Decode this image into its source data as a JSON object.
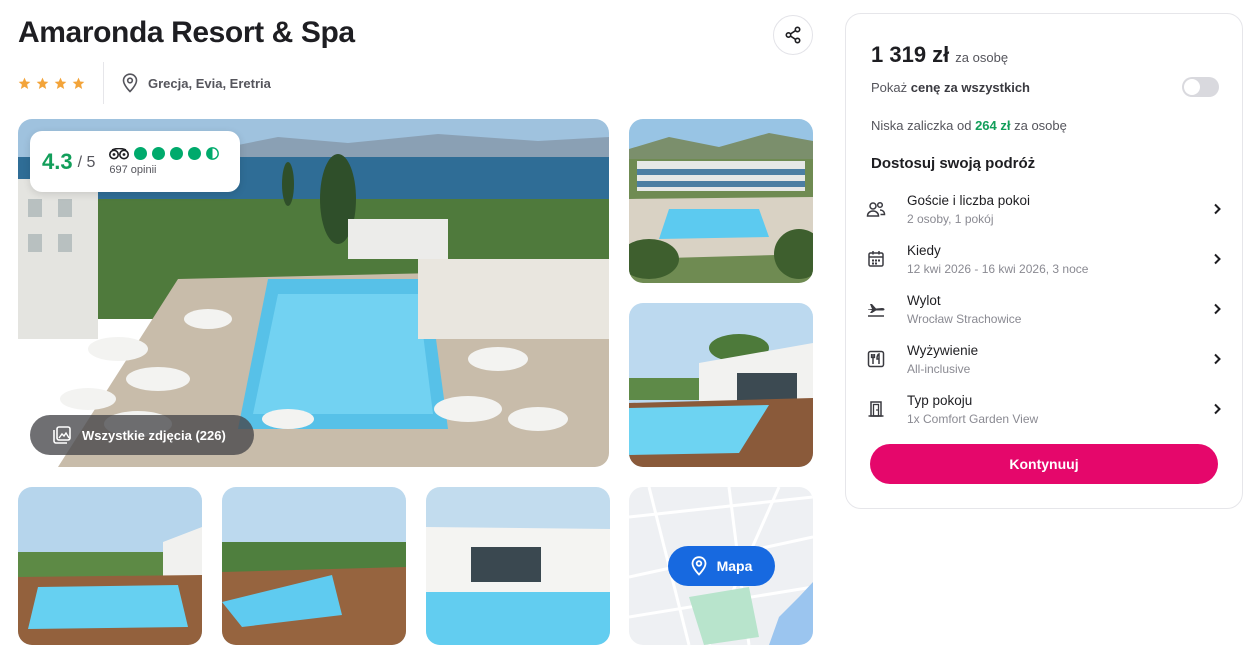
{
  "hotel": {
    "name": "Amaronda Resort & Spa",
    "stars": 4,
    "location": "Grecja, Evia, Eretria"
  },
  "rating": {
    "score": "4.3",
    "max": "/ 5",
    "tripadvisor_bubbles": 4.5,
    "reviews": "697 opinii"
  },
  "gallery": {
    "all_photos_label": "Wszystkie zdjęcia (226)",
    "map_label": "Mapa"
  },
  "booking": {
    "price": "1 319 zł",
    "per_person": "za osobę",
    "toggle_prefix": "Pokaż",
    "toggle_bold": "cenę za wszystkich",
    "deposit_prefix": "Niska zaliczka od",
    "deposit_amount": "264 zł",
    "deposit_suffix": "za osobę",
    "customize_title": "Dostosuj swoją podróż",
    "options": [
      {
        "title": "Goście i liczba pokoi",
        "value": "2 osoby, 1 pokój",
        "icon": "guests-icon"
      },
      {
        "title": "Kiedy",
        "value": "12 kwi 2026 - 16 kwi 2026, 3 noce",
        "icon": "calendar-icon"
      },
      {
        "title": "Wylot",
        "value": "Wrocław Strachowice",
        "icon": "plane-icon"
      },
      {
        "title": "Wyżywienie",
        "value": "All-inclusive",
        "icon": "meal-icon"
      },
      {
        "title": "Typ pokoju",
        "value": "1x Comfort Garden View",
        "icon": "door-icon"
      }
    ],
    "continue_label": "Kontynuuj"
  },
  "colors": {
    "accent": "#e5076b",
    "rating_green": "#129e5a",
    "tripadvisor_green": "#00aa6c",
    "map_blue": "#1769e0",
    "star": "#f3a43a"
  }
}
